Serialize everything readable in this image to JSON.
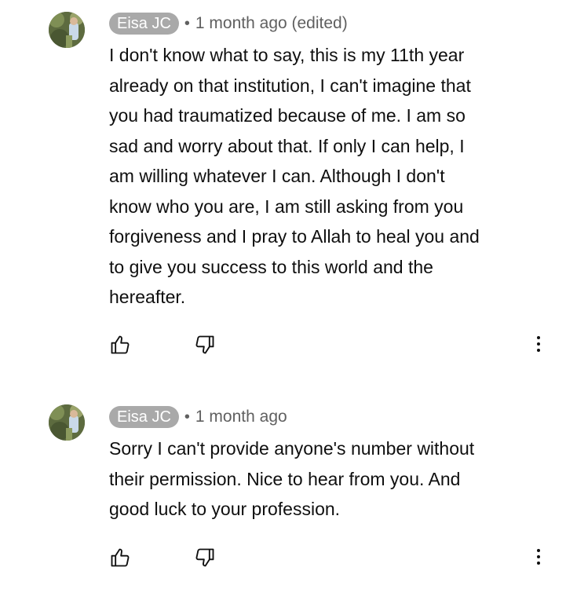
{
  "comments": [
    {
      "author": "Eisa JC",
      "separator": "•",
      "time": "1 month ago (edited)",
      "avatar_icon": "profile-photo",
      "lines": [
        "I don't know what to say, this is my 11th year",
        "already on that institution, I can't imagine that",
        "you had traumatized because of me. I am so",
        "sad and worry about that. If only I can help, I",
        "am willing whatever I can. Although I don't",
        "know who you are, I am still asking from you",
        "forgiveness and I pray to Allah to heal you and",
        "to give you success to this world and the",
        "hereafter."
      ],
      "actions": [
        "thumbs-up-icon",
        "thumbs-down-icon",
        "more-vert-icon"
      ]
    },
    {
      "author": "Eisa JC",
      "separator": "•",
      "time": "1 month ago",
      "avatar_icon": "profile-photo",
      "lines": [
        "Sorry I can't provide anyone's number without",
        "their permission. Nice to hear from you. And",
        "good luck to your profession."
      ],
      "actions": [
        "thumbs-up-icon",
        "thumbs-down-icon",
        "more-vert-icon"
      ]
    }
  ],
  "colors": {
    "author_chip_bg": "#a9a9a9",
    "author_chip_text": "#ffffff",
    "secondary_text": "#606060",
    "primary_text": "#0f0f0f"
  }
}
